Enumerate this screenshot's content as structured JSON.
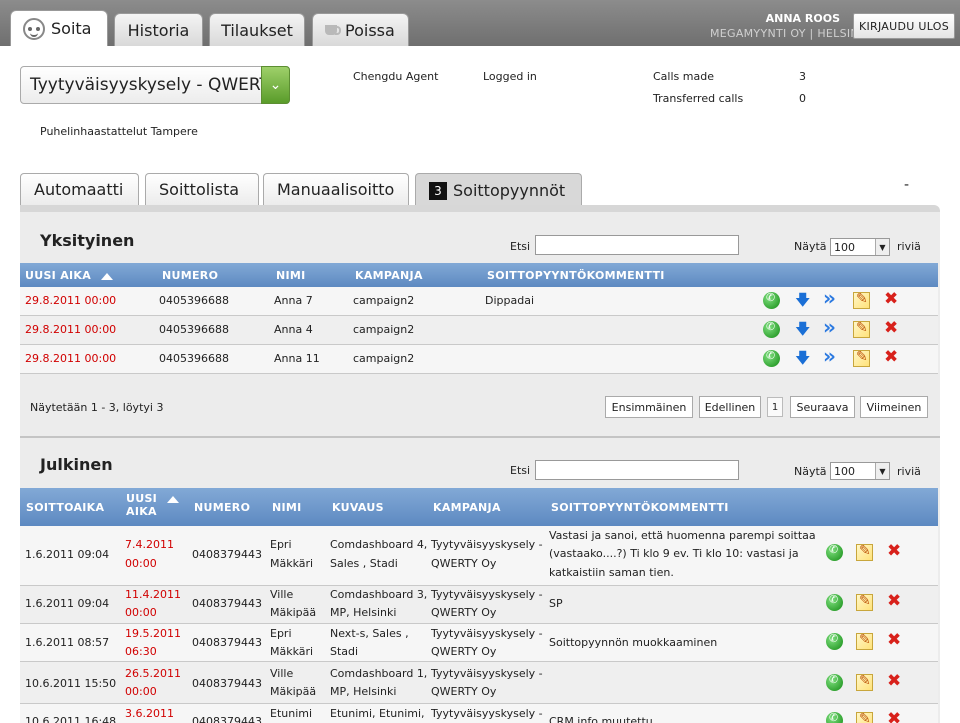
{
  "top_tabs": [
    {
      "label": "Soita",
      "icon": "face-icon"
    },
    {
      "label": "Historia"
    },
    {
      "label": "Tilaukset"
    },
    {
      "label": "Poissa",
      "icon": "coffee-cup-icon"
    }
  ],
  "user": {
    "name": "ANNA ROOS",
    "org": "MEGAMYYNTI OY | HELSINKI",
    "logout_label": "KIRJAUDU ULOS"
  },
  "campaign": {
    "selected": "Tyytyväisyyskysely - QWERTY Oy",
    "subtitle": "Puhelinhaastattelut Tampere"
  },
  "agent_info": {
    "agent": "Chengdu Agent",
    "status": "Logged in",
    "calls_made_label": "Calls made",
    "calls_made": "3",
    "transferred_label": "Transferred calls",
    "transferred": "0"
  },
  "sub_tabs": [
    {
      "label": "Automaatti"
    },
    {
      "label": "Soittolista"
    },
    {
      "label": "Manuaalisoitto"
    },
    {
      "badge": "3",
      "label": "Soittopyynnöt"
    }
  ],
  "dash": "-",
  "private": {
    "title": "Yksityinen",
    "search_label": "Etsi",
    "show_label": "Näytä",
    "page_size": "100",
    "rows_label": "riviä",
    "headers": [
      "UUSI AIKA",
      "NUMERO",
      "NIMI",
      "KAMPANJA",
      "SOITTOPYYNTÖKOMMENTTI"
    ],
    "rows": [
      {
        "date": "29.8.2011",
        "time": "00:00",
        "number": "0405396688",
        "name": "Anna 7",
        "campaign": "campaign2",
        "comment": "Dippadai"
      },
      {
        "date": "29.8.2011",
        "time": "00:00",
        "number": "0405396688",
        "name": "Anna 4",
        "campaign": "campaign2",
        "comment": ""
      },
      {
        "date": "29.8.2011",
        "time": "00:00",
        "number": "0405396688",
        "name": "Anna 11",
        "campaign": "campaign2",
        "comment": ""
      }
    ],
    "pager_text": "Näytetään 1 - 3, löytyi 3",
    "pager": {
      "first": "Ensimmäinen",
      "prev": "Edellinen",
      "page": "1",
      "next": "Seuraava",
      "last": "Viimeinen"
    }
  },
  "public": {
    "title": "Julkinen",
    "search_label": "Etsi",
    "show_label": "Näytä",
    "page_size": "100",
    "rows_label": "riviä",
    "headers": [
      "SOITTOAIKA",
      "UUSI AIKA",
      "NUMERO",
      "NIMI",
      "KUVAUS",
      "KAMPANJA",
      "SOITTOPYYNTÖKOMMENTTI"
    ],
    "header_uusi_line1": "UUSI",
    "header_uusi_line2": "AIKA",
    "rows": [
      {
        "call_time": "1.6.2011 09:04",
        "new_date": "7.4.2011",
        "new_time": "00:00",
        "number": "0408379443",
        "name1": "Epri",
        "name2": "Mäkkäri",
        "desc1": "Comdashboard 4,",
        "desc2": "Sales , Stadi",
        "camp1": "Tyytyväisyyskysely -",
        "camp2": "QWERTY Oy",
        "c1": "Vastasi ja sanoi, että huomenna parempi soittaa",
        "c2": "(vastaako....?) Ti klo 9 ev. Ti klo 10: vastasi ja",
        "c3": "katkaistiin saman tien."
      },
      {
        "call_time": "1.6.2011 09:04",
        "new_date": "11.4.2011",
        "new_time": "00:00",
        "number": "0408379443",
        "name1": "Ville",
        "name2": "Mäkipää",
        "desc1": "Comdashboard 3,",
        "desc2": "MP, Helsinki",
        "camp1": "Tyytyväisyyskysely -",
        "camp2": "QWERTY Oy",
        "c1": "SP",
        "c2": "",
        "c3": ""
      },
      {
        "call_time": "1.6.2011 08:57",
        "new_date": "19.5.2011",
        "new_time": "06:30",
        "number": "0408379443",
        "name1": "Epri",
        "name2": "Mäkkäri",
        "desc1": "Next-s, Sales ,",
        "desc2": "Stadi",
        "camp1": "Tyytyväisyyskysely -",
        "camp2": "QWERTY Oy",
        "c1": "Soittopyynnön muokkaaminen",
        "c2": "",
        "c3": ""
      },
      {
        "call_time": "10.6.2011 15:50",
        "new_date": "26.5.2011",
        "new_time": "00:00",
        "number": "0408379443",
        "name1": "Ville",
        "name2": "Mäkipää",
        "desc1": "Comdashboard 1,",
        "desc2": "MP, Helsinki",
        "camp1": "Tyytyväisyyskysely -",
        "camp2": "QWERTY Oy",
        "c1": "",
        "c2": "",
        "c3": ""
      },
      {
        "call_time": "10.6.2011 16:48",
        "new_date": "3.6.2011",
        "new_time": "",
        "number": "0408379443",
        "name1": "Etunimi",
        "name2": "",
        "desc1": "Etunimi, Etunimi,",
        "desc2": "",
        "camp1": "Tyytyväisyyskysely -",
        "camp2": "",
        "c1": "CRM info muutettu",
        "c2": "",
        "c3": ""
      }
    ]
  }
}
